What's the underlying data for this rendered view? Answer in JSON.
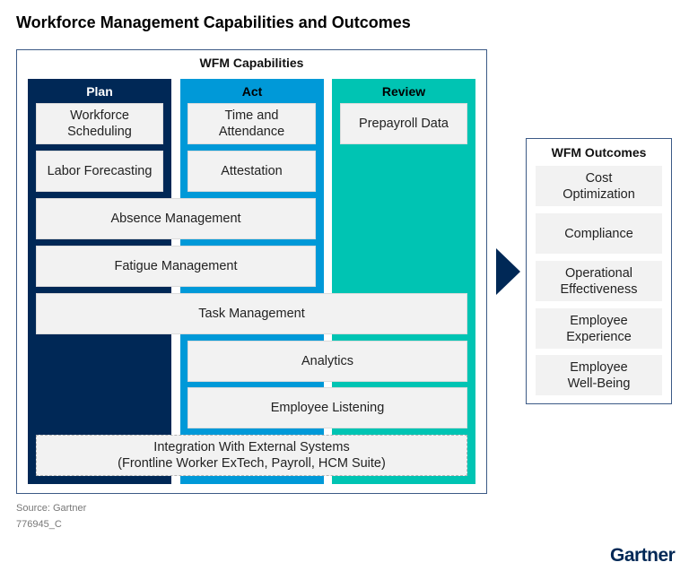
{
  "title": "Workforce Management Capabilities and Outcomes",
  "capabilities": {
    "heading": "WFM Capabilities",
    "columns": [
      {
        "label": "Plan",
        "color": "#002856"
      },
      {
        "label": "Act",
        "color": "#0099d8"
      },
      {
        "label": "Review",
        "color": "#00c4b3"
      }
    ],
    "items": {
      "workforce_scheduling": "Workforce Scheduling",
      "labor_forecasting": "Labor Forecasting",
      "time_and_attendance": "Time and Attendance",
      "attestation": "Attestation",
      "prepayroll_data": "Prepayroll Data",
      "absence_management": "Absence Management",
      "fatigue_management": "Fatigue Management",
      "task_management": "Task Management",
      "analytics": "Analytics",
      "employee_listening": "Employee Listening",
      "integration_line1": "Integration With External Systems",
      "integration_line2": "(Frontline Worker ExTech, Payroll, HCM Suite)"
    }
  },
  "outcomes": {
    "heading": "WFM Outcomes",
    "items": [
      "Cost Optimization",
      "Compliance",
      "Operational Effectiveness",
      "Employee Experience",
      "Employee Well-Being"
    ]
  },
  "footer": {
    "source": "Source: Gartner",
    "id": "776945_C"
  },
  "logo": "Gartner"
}
